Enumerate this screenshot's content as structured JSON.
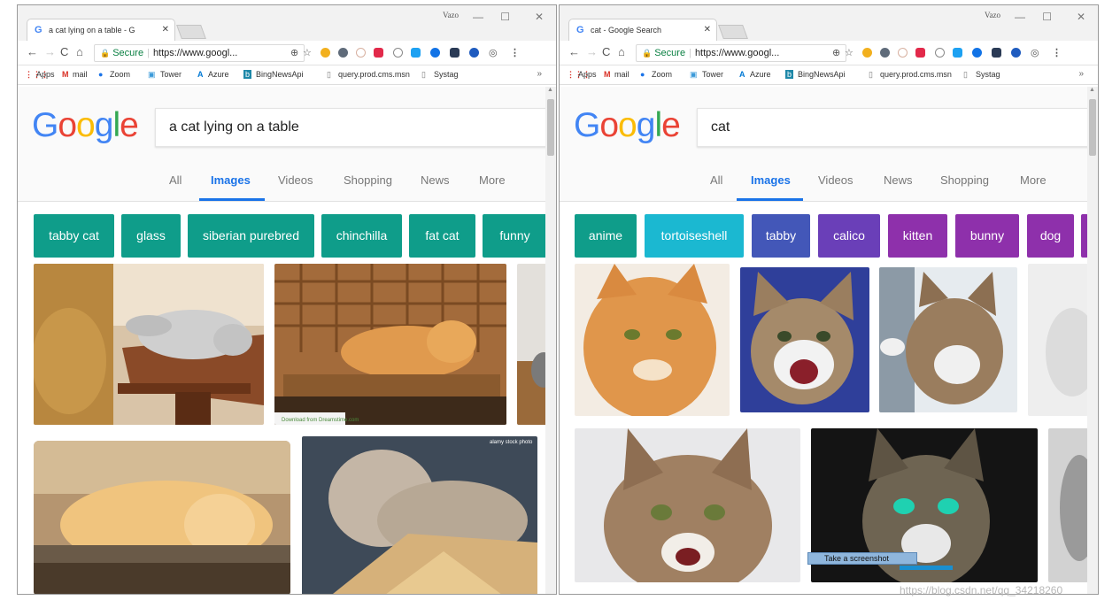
{
  "left_window": {
    "tab_title": "a cat lying on a table - G",
    "profile_label": "Vazo",
    "omnibox": {
      "secure_label": "Secure",
      "url": "https://www.googl..."
    },
    "bookmarks": [
      "Apps",
      "mail",
      "Zoom",
      "Tower",
      "Azure",
      "BingNewsApi",
      "query.prod.cms.msn",
      "Systag"
    ],
    "search_query": "a cat lying on a table",
    "search_tabs": [
      "All",
      "Images",
      "Videos",
      "Shopping",
      "News",
      "More"
    ],
    "active_tab": "Images",
    "chips": [
      {
        "label": "tabby cat",
        "color": "#0f9d8a"
      },
      {
        "label": "glass",
        "color": "#0f9d8a"
      },
      {
        "label": "siberian purebred",
        "color": "#0f9d8a"
      },
      {
        "label": "chinchilla",
        "color": "#0f9d8a"
      },
      {
        "label": "fat cat",
        "color": "#0f9d8a"
      },
      {
        "label": "funny",
        "color": "#0f9d8a"
      }
    ],
    "image_caption": "Download from Dreamstime.com",
    "image_watermark": "alamy stock photo"
  },
  "right_window": {
    "tab_title": "cat - Google Search",
    "profile_label": "Vazo",
    "omnibox": {
      "secure_label": "Secure",
      "url": "https://www.googl..."
    },
    "bookmarks": [
      "Apps",
      "mail",
      "Zoom",
      "Tower",
      "Azure",
      "BingNewsApi",
      "query.prod.cms.msn",
      "Systag"
    ],
    "search_query": "cat",
    "search_tabs": [
      "All",
      "Images",
      "Videos",
      "News",
      "Shopping",
      "More"
    ],
    "active_tab": "Images",
    "chips": [
      {
        "label": "anime",
        "color": "#0f9d8a"
      },
      {
        "label": "tortoiseshell",
        "color": "#1bb8d1"
      },
      {
        "label": "tabby",
        "color": "#4357b8"
      },
      {
        "label": "calico",
        "color": "#6a3fb8"
      },
      {
        "label": "kitten",
        "color": "#8e30ab"
      },
      {
        "label": "bunny",
        "color": "#8e30ab"
      },
      {
        "label": "dog",
        "color": "#8e30ab"
      }
    ],
    "tooltip": "Take a screenshot"
  },
  "google_logo": {
    "letters": [
      "G",
      "o",
      "o",
      "g",
      "l",
      "e"
    ],
    "colors": [
      "#4285f4",
      "#ea4335",
      "#fbbc05",
      "#4285f4",
      "#34a853",
      "#ea4335"
    ]
  },
  "watermark": "https://blog.csdn.net/qq_34218260"
}
